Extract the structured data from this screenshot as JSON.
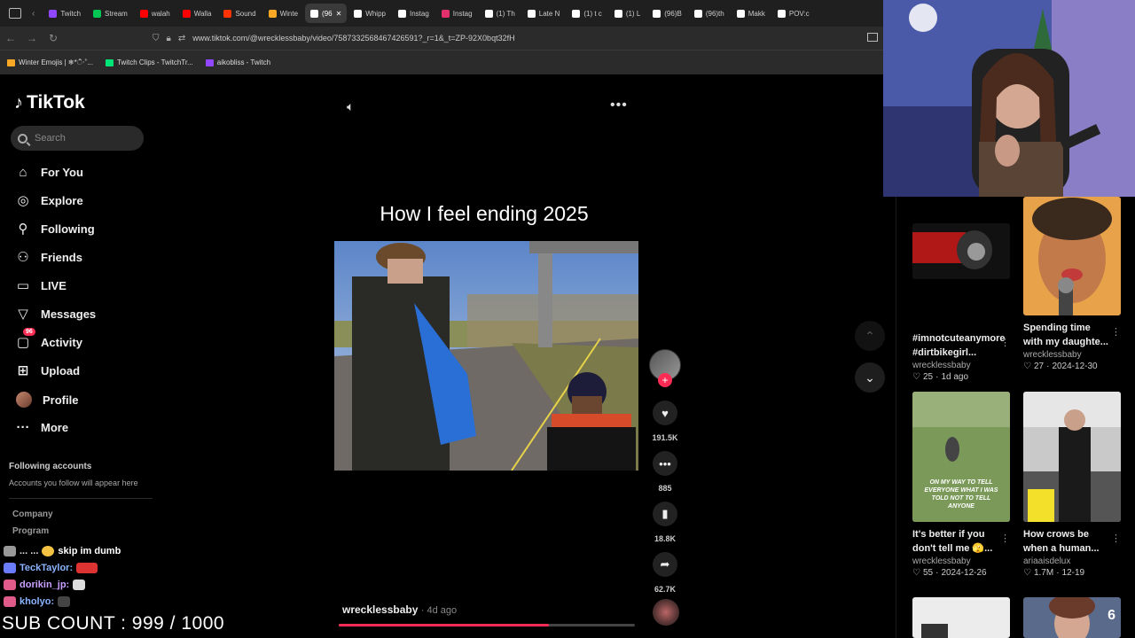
{
  "browser": {
    "tabs": [
      {
        "label": "Twitch",
        "color": "#9146ff"
      },
      {
        "label": "Stream",
        "color": "#00c853"
      },
      {
        "label": "walah",
        "color": "#ff0000"
      },
      {
        "label": "Walla",
        "color": "#ff0000"
      },
      {
        "label": "Sound",
        "color": "#ff3300"
      },
      {
        "label": "Winte",
        "color": "#f9a825"
      },
      {
        "label": "(96",
        "color": "#ffffff",
        "active": true
      },
      {
        "label": "Whipp",
        "color": "#ffffff"
      },
      {
        "label": "Instag",
        "color": "#ffffff"
      },
      {
        "label": "Instag",
        "color": "#e1306c"
      },
      {
        "label": "(1) Th",
        "color": "#ffffff"
      },
      {
        "label": "Late N",
        "color": "#ffffff"
      },
      {
        "label": "(1) t c",
        "color": "#ffffff"
      },
      {
        "label": "(1) L",
        "color": "#ffffff"
      },
      {
        "label": "(96)B",
        "color": "#ffffff"
      },
      {
        "label": "(96)th",
        "color": "#ffffff"
      },
      {
        "label": "Makk",
        "color": "#ffffff"
      },
      {
        "label": "POV:c",
        "color": "#ffffff"
      }
    ],
    "url": "www.tiktok.com/@wrecklessbaby/video/7587332568467426591?_r=1&_t=ZP-92X0bqt32fH",
    "bookmarks": [
      {
        "label": "Winter Emojis | ❄*ੈ‧˚...",
        "color": "#f9a825"
      },
      {
        "label": "Twitch Clips - TwitchTr...",
        "color": "#00e676"
      },
      {
        "label": "aikobliss - Twitch",
        "color": "#9146ff"
      }
    ]
  },
  "sidebar": {
    "logo": "TikTok",
    "search_placeholder": "Search",
    "nav": [
      {
        "label": "For You",
        "icon": "home-icon"
      },
      {
        "label": "Explore",
        "icon": "compass-icon"
      },
      {
        "label": "Following",
        "icon": "user-follow-icon"
      },
      {
        "label": "Friends",
        "icon": "friends-icon"
      },
      {
        "label": "LIVE",
        "icon": "live-icon"
      },
      {
        "label": "Messages",
        "icon": "messages-icon"
      },
      {
        "label": "Activity",
        "icon": "activity-icon",
        "badge": "96"
      },
      {
        "label": "Upload",
        "icon": "upload-icon"
      },
      {
        "label": "Profile",
        "icon": "avatar"
      },
      {
        "label": "More",
        "icon": "more-icon"
      }
    ],
    "following_title": "Following accounts",
    "following_sub": "Accounts you follow will appear here",
    "footer_links": [
      "Company",
      "Program"
    ]
  },
  "chat": [
    {
      "user": "... ...",
      "message": "skip im dumb",
      "user_color": "#ffffff"
    },
    {
      "user": "TeckTaylor:",
      "message": "",
      "user_color": "#8ab4ff"
    },
    {
      "user": "dorikin_jp:",
      "message": "",
      "user_color": "#8ab4ff"
    },
    {
      "user": "kholyo:",
      "message": "",
      "user_color": "#8ab4ff"
    }
  ],
  "sub_count": "SUB COUNT : 999 / 1000",
  "video": {
    "title": "How I feel ending 2025",
    "author": "wrecklessbaby",
    "age": "· 4d ago",
    "progress": 0.71,
    "likes": "191.5K",
    "comments": "885",
    "saves": "18.8K",
    "shares": "62.7K"
  },
  "grid": [
    {
      "title": "#imnotcuteanymore #dirtbikegirl...",
      "author": "wrecklessbaby",
      "likes": "25",
      "date": "1d ago"
    },
    {
      "title": "Spending time with my daughte...",
      "author": "wrecklessbaby",
      "likes": "27",
      "date": "2024-12-30"
    },
    {
      "title": "It's better if you don't tell me 🫣...",
      "author": "wrecklessbaby",
      "likes": "55",
      "date": "2024-12-26",
      "thumb_caption": "ON MY WAY TO TELL EVERYONE WHAT I WAS TOLD NOT TO TELL ANYONE"
    },
    {
      "title": "How crows be when a human...",
      "author": "ariaaisdelux",
      "likes": "1.7M",
      "date": "12-19"
    },
    {
      "title": "",
      "author": "",
      "likes": "",
      "date": ""
    },
    {
      "title": "",
      "author": "",
      "likes": "",
      "date": "",
      "overlay": "6"
    }
  ]
}
